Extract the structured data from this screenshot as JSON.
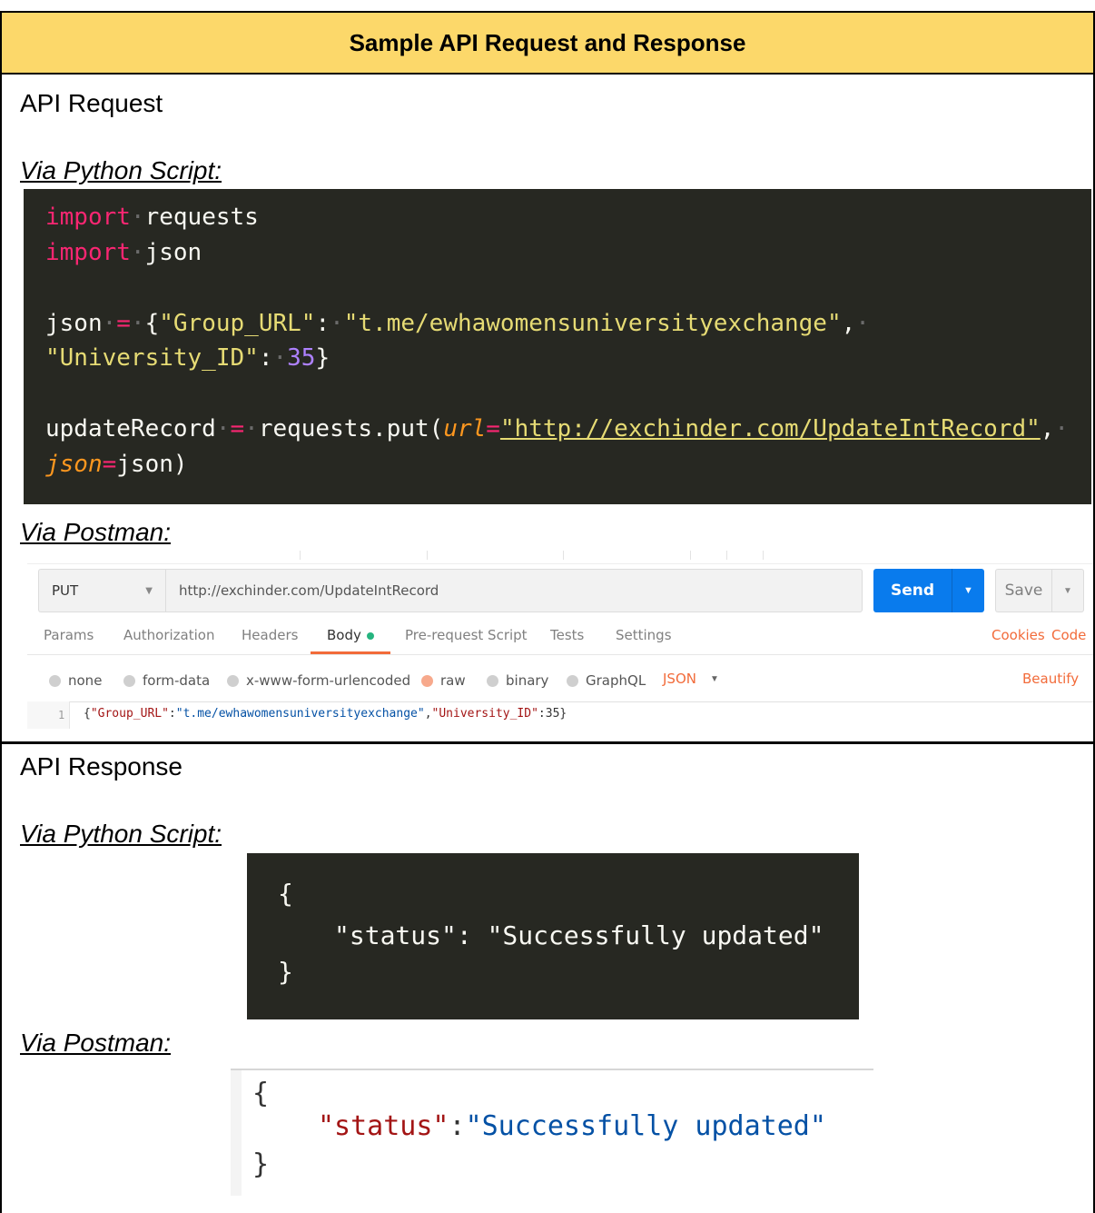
{
  "title": "Sample API Request and Response",
  "request": {
    "heading": "API Request",
    "python_label": "Via Python Script:",
    "postman_label": "Via Postman:",
    "python_code": {
      "line1_kw": "import",
      "line1_rest": "requests",
      "line2_kw": "import",
      "line2_rest": "json",
      "line3_var": "json",
      "line3_eq": "=",
      "line3_key": "\"Group_URL\"",
      "line3_val": "\"t.me/ewhawomensuniversityexchange\"",
      "line4_key": "\"University_ID\"",
      "line4_num": "35",
      "line5_var": "updateRecord",
      "line5_call": "requests.put(",
      "line5_param": "url",
      "line5_url": "\"http://exchinder.com/UpdateIntRecord\"",
      "line6_param": "json",
      "line6_rest": "json)"
    },
    "postman": {
      "method": "PUT",
      "url": "http://exchinder.com/UpdateIntRecord",
      "send": "Send",
      "save": "Save",
      "tabs": [
        "Params",
        "Authorization",
        "Headers",
        "Body",
        "Pre-request Script",
        "Tests",
        "Settings"
      ],
      "cookies": "Cookies",
      "code": "Code",
      "body_modes": [
        "none",
        "form-data",
        "x-www-form-urlencoded",
        "raw",
        "binary",
        "GraphQL"
      ],
      "body_format": "JSON",
      "beautify": "Beautify",
      "line_number": "1",
      "body_key1": "\"Group_URL\"",
      "body_val1": "\"t.me/ewhawomensuniversityexchange\"",
      "body_key2": "\"University_ID\"",
      "body_val2": "35"
    }
  },
  "response": {
    "heading": "API Response",
    "python_label": "Via Python Script:",
    "postman_label": "Via Postman:",
    "python_output": {
      "open": "{",
      "key": "\"status\"",
      "value": "\"Successfully updated\"",
      "close": "}"
    },
    "postman_output": {
      "open": "{",
      "key": "\"status\"",
      "value": "\"Successfully updated\"",
      "close": "}"
    }
  }
}
